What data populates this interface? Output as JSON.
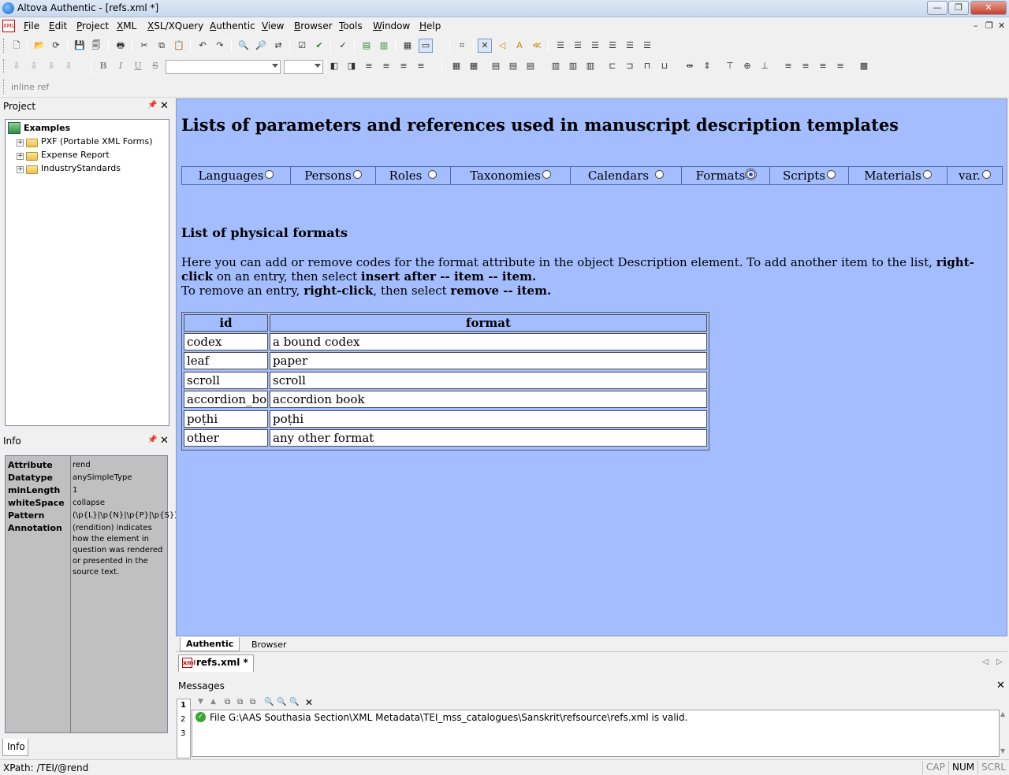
{
  "window": {
    "title": "Altova Authentic - [refs.xml *]"
  },
  "menu": [
    "File",
    "Edit",
    "Project",
    "XML",
    "XSL/XQuery",
    "Authentic",
    "View",
    "Browser",
    "Tools",
    "Window",
    "Help"
  ],
  "toolbar3": {
    "label": "inline ref"
  },
  "project": {
    "title": "Project",
    "root": "Examples",
    "items": [
      "PXF (Portable XML Forms)",
      "Expense Report",
      "IndustryStandards"
    ]
  },
  "info": {
    "title": "Info",
    "rows": [
      {
        "k": "Attribute",
        "v": "rend"
      },
      {
        "k": "Datatype",
        "v": "anySimpleType"
      },
      {
        "k": "minLength",
        "v": "1"
      },
      {
        "k": "whiteSpace",
        "v": "collapse"
      },
      {
        "k": "Pattern",
        "v": "(\\p{L}|\\p{N}|\\p{P}|\\p{S})+"
      },
      {
        "k": "Annotation",
        "v": "(rendition) indicates how the element in question was rendered or presented in the source text."
      }
    ],
    "tab": "Info"
  },
  "document": {
    "title": "Lists of parameters and references used in manuscript description templates",
    "tabs": [
      "Languages",
      "Persons",
      "Roles",
      "Taxonomies",
      "Calendars",
      "Formats",
      "Scripts",
      "Materials",
      "var."
    ],
    "selected_tab": "Formats",
    "heading": "List of physical formats",
    "para": {
      "p1": "Here you can add or remove codes for the format attribute in the object Description element. To add another item to the list,",
      "b1": "right-click",
      "p2": "on an entry, then select",
      "b2": "insert after -- item --  item.",
      "p3": "To remove an entry,",
      "b3": "right-click",
      "p4": ", then select",
      "b4": "remove -- item."
    },
    "table": {
      "headers": [
        "id",
        "format"
      ],
      "rows": [
        [
          "codex",
          "a bound codex"
        ],
        [
          "leaf",
          "paper"
        ],
        [
          "scroll",
          "scroll"
        ],
        [
          "accordion_book",
          "accordion book"
        ],
        [
          "poṭhi",
          "poṭhi"
        ],
        [
          "other",
          "any other format"
        ]
      ]
    }
  },
  "view_tabs": [
    "Authentic",
    "Browser"
  ],
  "file_tab": "refs.xml *",
  "messages": {
    "title": "Messages",
    "side_tabs": [
      "1",
      "2",
      "3"
    ],
    "text": "File G:\\AAS Southasia Section\\XML Metadata\\TEI_mss_catalogues\\Sanskrit\\refsource\\refs.xml is valid."
  },
  "status": {
    "xpath": "XPath: /TEI/@rend",
    "indicators": [
      "CAP",
      "NUM",
      "SCRL"
    ]
  }
}
